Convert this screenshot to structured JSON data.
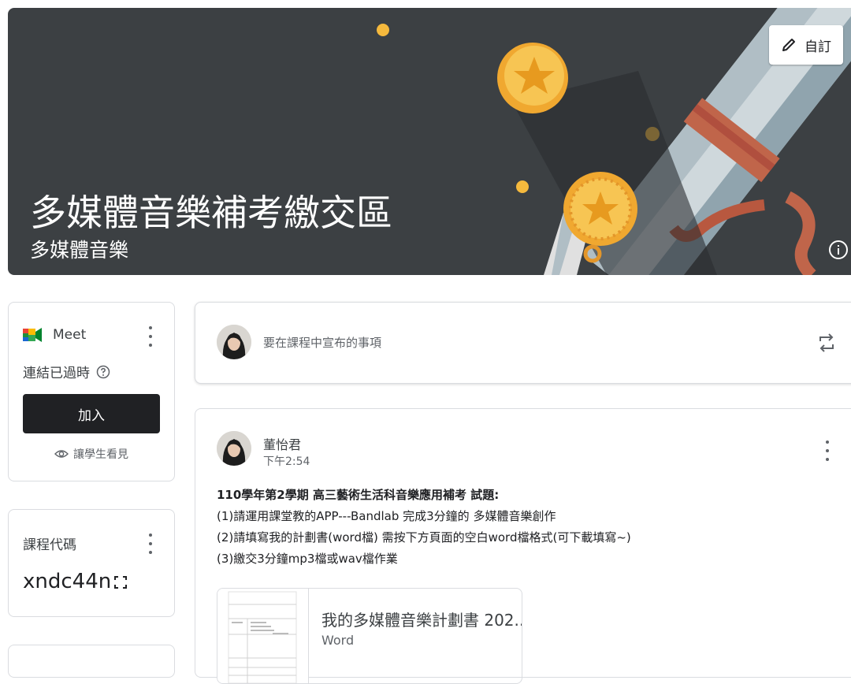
{
  "banner": {
    "title": "多媒體音樂補考繳交區",
    "subtitle": "多媒體音樂",
    "customize_label": "自訂"
  },
  "meet": {
    "label": "Meet",
    "status": "連結已過時",
    "join_label": "加入",
    "visibility_note": "讓學生看見"
  },
  "class_code": {
    "label": "課程代碼",
    "value": "xndc44n"
  },
  "announce": {
    "placeholder": "要在課程中宣布的事項"
  },
  "post": {
    "author": "董怡君",
    "time": "下午2:54",
    "title": "110學年第2學期 高三藝術生活科音樂應用補考 試題:",
    "lines": [
      "(1)請運用課堂教的APP---Bandlab 完成3分鐘的 多媒體音樂創作",
      "(2)請填寫我的計劃書(word檔) 需按下方頁面的空白word檔格式(可下載填寫~)",
      "(3)繳交3分鐘mp3檔或wav檔作業"
    ],
    "attachment": {
      "title": "我的多媒體音樂計劃書 202...",
      "type": "Word"
    }
  },
  "icons": [
    "pencil-icon",
    "info-icon",
    "meet-icon",
    "help-icon",
    "eye-icon",
    "fullscreen-icon",
    "repost-icon",
    "kebab-icon"
  ],
  "colors": {
    "banner": "#3c4043",
    "join_button": "#202124",
    "medal_gold": "#f5b93d",
    "ribbon": "#c0654a"
  }
}
